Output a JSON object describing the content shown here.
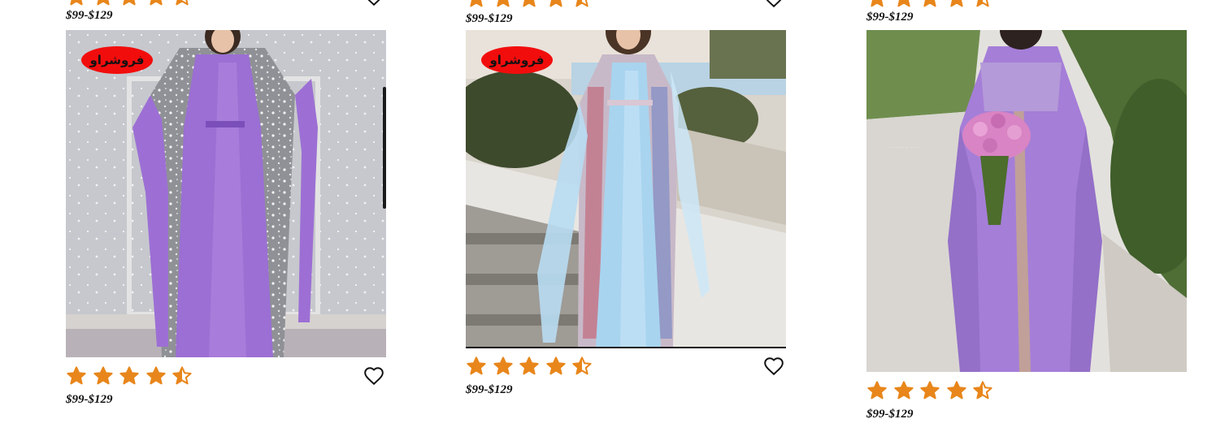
{
  "products": [
    {
      "price_top": "$99-$129",
      "badge": "فروشراو",
      "rating": 4.5,
      "price": "$99-$129",
      "dress_color": "#9b6fd3",
      "background_color": "#c9cbd0"
    },
    {
      "price_top": "$99-$129",
      "badge": "فروشراو",
      "rating": 4.5,
      "price": "$99-$129",
      "dress_color": "#a8d4ef",
      "background_color": "#d9d4cc"
    },
    {
      "price_top": "$99-$129",
      "rating": 4.5,
      "price": "$99-$129",
      "dress_color": "#a57ed8",
      "background_color": "#6f8e4e"
    }
  ],
  "icons": {
    "star": "star-outline-icon",
    "half_star": "star-half-icon",
    "wishlist": "heart-outline-icon"
  },
  "colors": {
    "star": "#e8861b",
    "badge": "#f20d0d",
    "text": "#111111"
  }
}
